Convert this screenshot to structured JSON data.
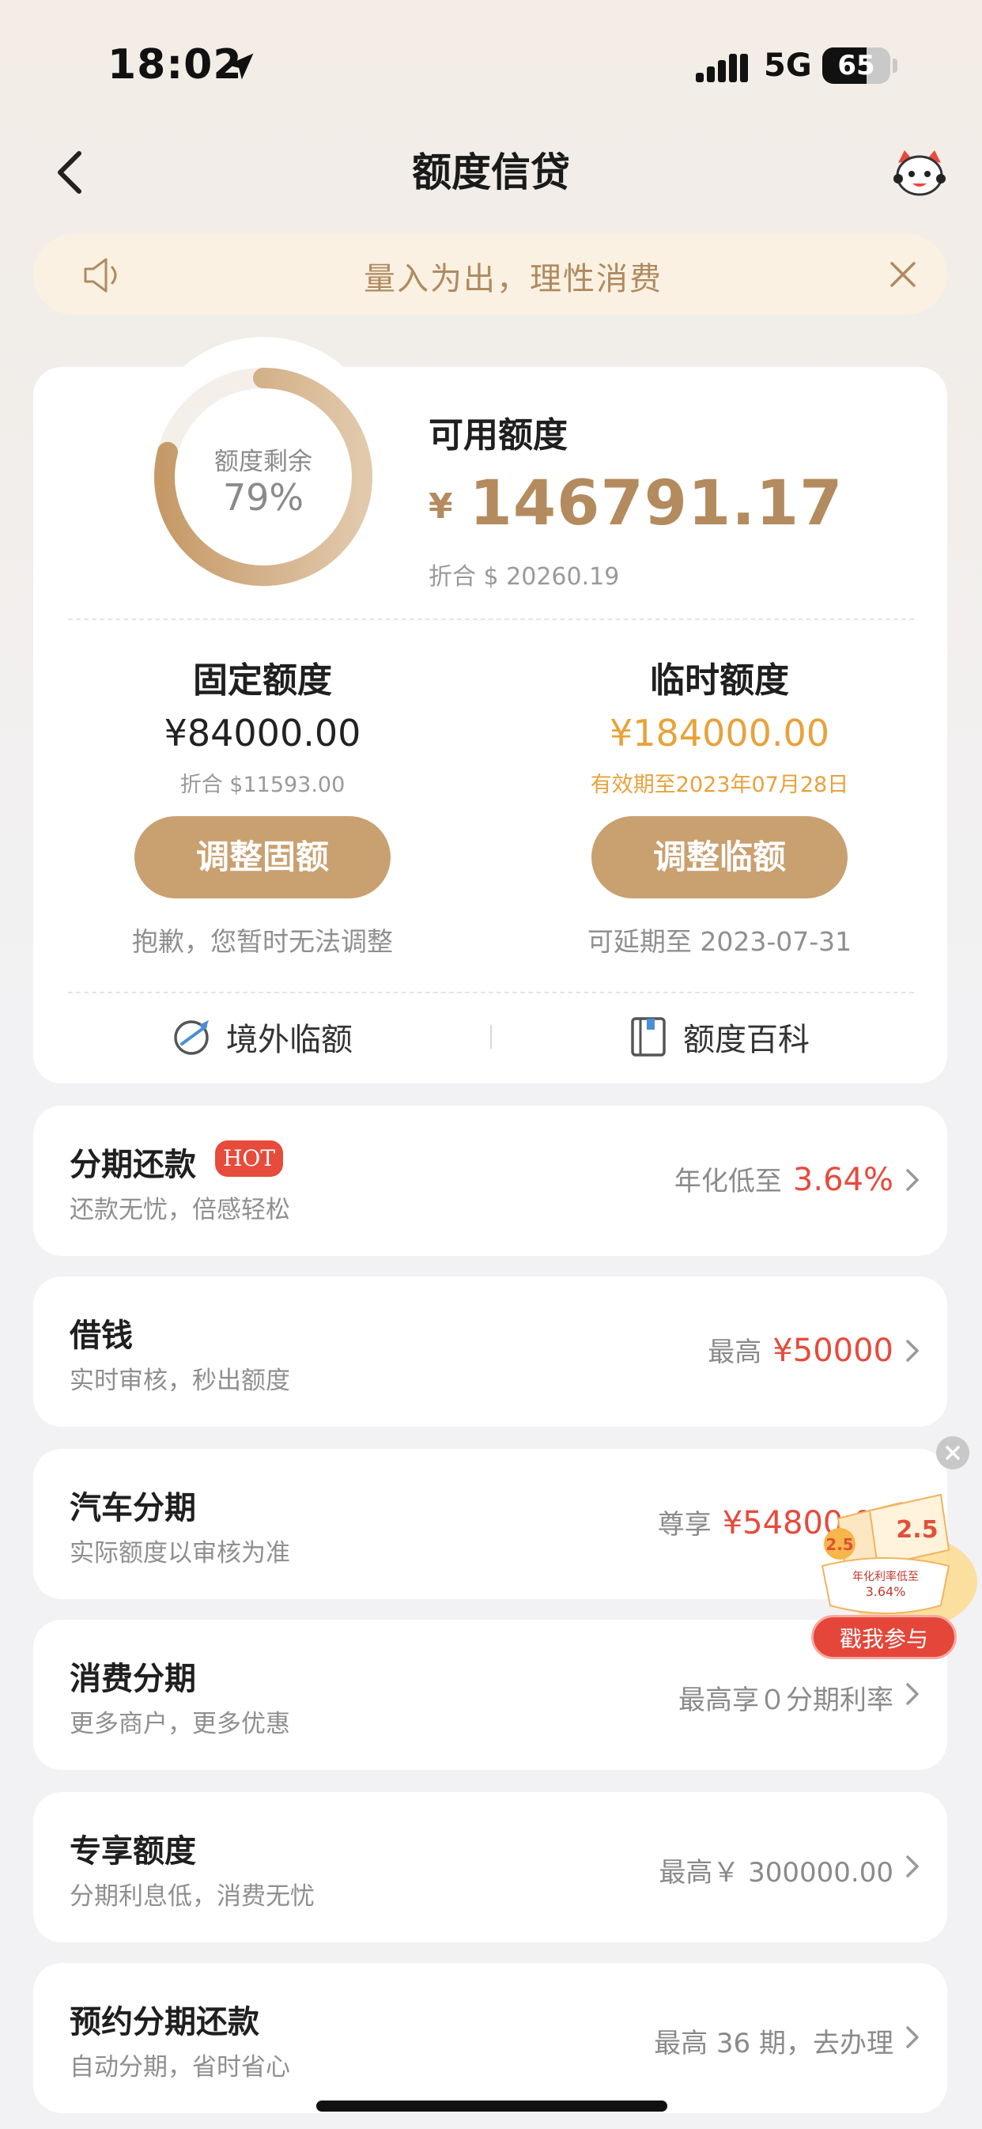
{
  "status_bar": {
    "time": "18:02",
    "network": "5G",
    "battery": "65",
    "battery_level": 0.65
  },
  "nav": {
    "title": "额度信贷",
    "back_icon": "chevron-left-icon",
    "mascot_icon": "mascot-avatar-icon"
  },
  "notice": {
    "text": "量入为出，理性消费",
    "speaker_icon": "speaker-icon",
    "close_icon": "close-icon"
  },
  "credit": {
    "ring_label": "额度剩余",
    "ring_percent_text": "79%",
    "ring_fraction": 0.79,
    "available_label": "可用额度",
    "currency": "¥",
    "available_amount": "146791.17",
    "available_usd": "折合 $ 20260.19",
    "fixed": {
      "title": "固定额度",
      "amount": "¥84000.00",
      "sub": "折合 $11593.00",
      "button": "调整固额",
      "note": "抱歉，您暂时无法调整"
    },
    "temp": {
      "title": "临时额度",
      "amount": "¥184000.00",
      "sub": "有效期至2023年07月28日",
      "button": "调整临额",
      "note": "可延期至 2023-07-31"
    },
    "links": [
      {
        "label": "境外临额",
        "icon": "globe-plane-icon"
      },
      {
        "label": "额度百科",
        "icon": "book-icon"
      }
    ]
  },
  "rows": [
    {
      "title": "分期还款",
      "badge": "HOT",
      "sub": "还款无忧，倍感轻松",
      "right_label": "年化低至",
      "right_value": "3.64%"
    },
    {
      "title": "借钱",
      "sub": "实时审核，秒出额度",
      "right_label": "最高",
      "right_value": "¥50000"
    },
    {
      "title": "汽车分期",
      "sub": "实际额度以审核为准",
      "right_label": "尊享",
      "right_value": "¥54800.00"
    },
    {
      "title": "消费分期",
      "sub": "更多商户，更多优惠",
      "right_label": "最高享０分期利率",
      "right_value": ""
    },
    {
      "title": "专享额度",
      "sub": "分期利息低，消费无忧",
      "right_label": "最高￥ 300000.00",
      "right_value": ""
    },
    {
      "title": "预约分期还款",
      "sub": "自动分期，省时省心",
      "right_label": "最高 36 期，去办理",
      "right_value": ""
    }
  ],
  "promo": {
    "button": "戳我参与",
    "rate_badge": "2.5",
    "rate_text": "年化利率低至",
    "rate_value": "3.64%"
  },
  "colors": {
    "accent_gold": "#b38b5e",
    "button_gold": "#c9a070",
    "highlight_red": "#e64b3c",
    "temp_orange": "#e8a23a"
  }
}
